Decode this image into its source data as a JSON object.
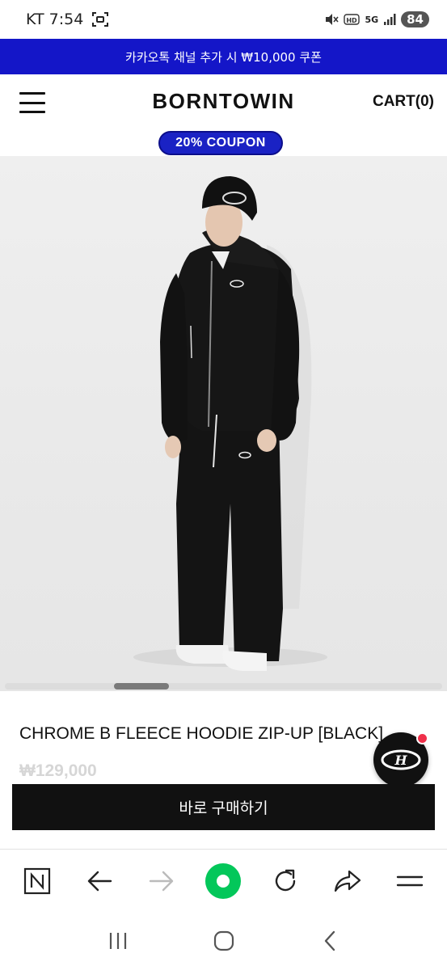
{
  "status_bar": {
    "carrier_time": "KT 7:54",
    "network": "5G",
    "battery": "84",
    "icons": [
      "screenshot-icon",
      "mute-icon",
      "hd-icon",
      "signal-icon",
      "battery-icon"
    ]
  },
  "promo_banner": {
    "text": "카카오톡 채널 추가 시 ₩10,000 쿠폰",
    "bg_color": "#1416c8"
  },
  "header": {
    "logo": "BORNTOWIN",
    "cart_label": "CART(0)",
    "coupon_label": "20% COUPON",
    "coupon_color": "#1a22c4"
  },
  "product": {
    "title": "CHROME B FLEECE HOODIE ZIP-UP [BLACK]",
    "price": "₩129,000",
    "buy_button_label": "바로 구매하기",
    "image_alt": "model-wearing-black-hoodie-zip-up-and-pants"
  },
  "gallery": {
    "scroll_position": 0.26
  },
  "browser_toolbar": {
    "items": [
      "naver-home-icon",
      "back-arrow-icon",
      "forward-arrow-icon",
      "green-center-icon",
      "reload-icon",
      "share-icon",
      "menu-icon"
    ],
    "accent_color": "#03c75a"
  },
  "system_nav": {
    "items": [
      "recent-apps-icon",
      "home-icon",
      "back-icon"
    ]
  }
}
